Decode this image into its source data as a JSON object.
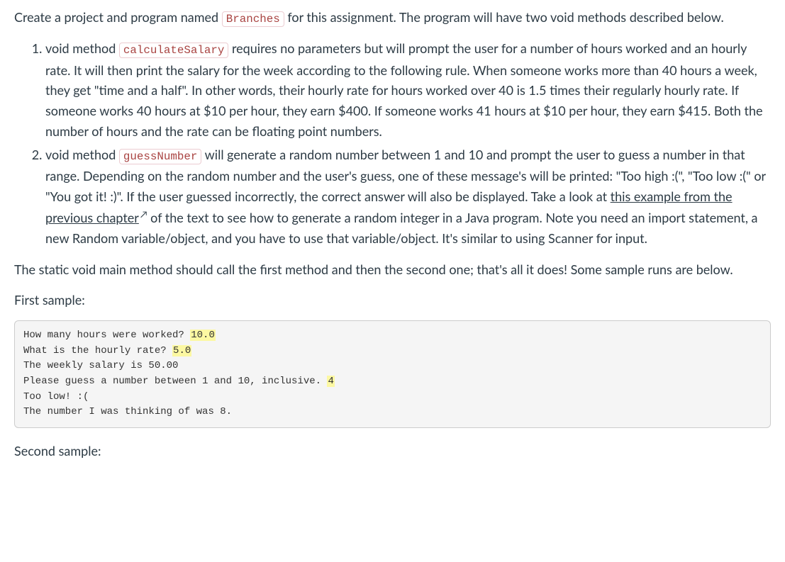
{
  "intro": {
    "pre": "Create a project and program named ",
    "code": "Branches",
    "post": " for this assignment. The program will have two void methods described below."
  },
  "items": [
    {
      "a": "void method ",
      "code": "calculateSalary",
      "b": " requires no parameters but will prompt the user for a number of hours worked and an hourly rate. It will then print the salary for the week according to the following rule. When someone works more than 40 hours a week, they get \"time and a half\". In other words, their hourly rate for hours worked over 40 is 1.5 times their regularly hourly rate. If someone works 40 hours at $10 per hour, they earn $400. If someone works 41 hours at $10 per hour, they earn $415. Both the number of hours and the rate can be floating point numbers."
    },
    {
      "a": "void method ",
      "code": "guessNumber",
      "b": " will generate a random number between 1 and 10 and prompt the user to guess a number in that range. Depending on the random number and the user's guess, one of these message's will be printed: \"Too high :(\", \"Too low :(\" or \"You got it! :)\".  If the user guessed incorrectly, the correct answer will also be displayed. Take a look at ",
      "link": "this example from the previous chapter",
      "c": " of the text to see how to generate a random integer in a Java program. Note you need an import statement, a new Random variable/object, and you have to use that variable/object. It's similar to using Scanner for input."
    }
  ],
  "afterList": "The static void main method should call the first method and then the second one; that's all it does! Some sample runs are below.",
  "firstSampleLabel": "First sample:",
  "sample1": {
    "l1a": "How many hours were worked? ",
    "l1b": "10.0",
    "l2a": "What is the hourly rate? ",
    "l2b": "5.0",
    "l3": "The weekly salary is 50.00",
    "l4a": "Please guess a number between 1 and 10, inclusive. ",
    "l4b": "4",
    "l5": "Too low! :(",
    "l6": "The number I was thinking of was 8."
  },
  "secondSampleLabel": "Second sample:",
  "externalIcon": "↗"
}
